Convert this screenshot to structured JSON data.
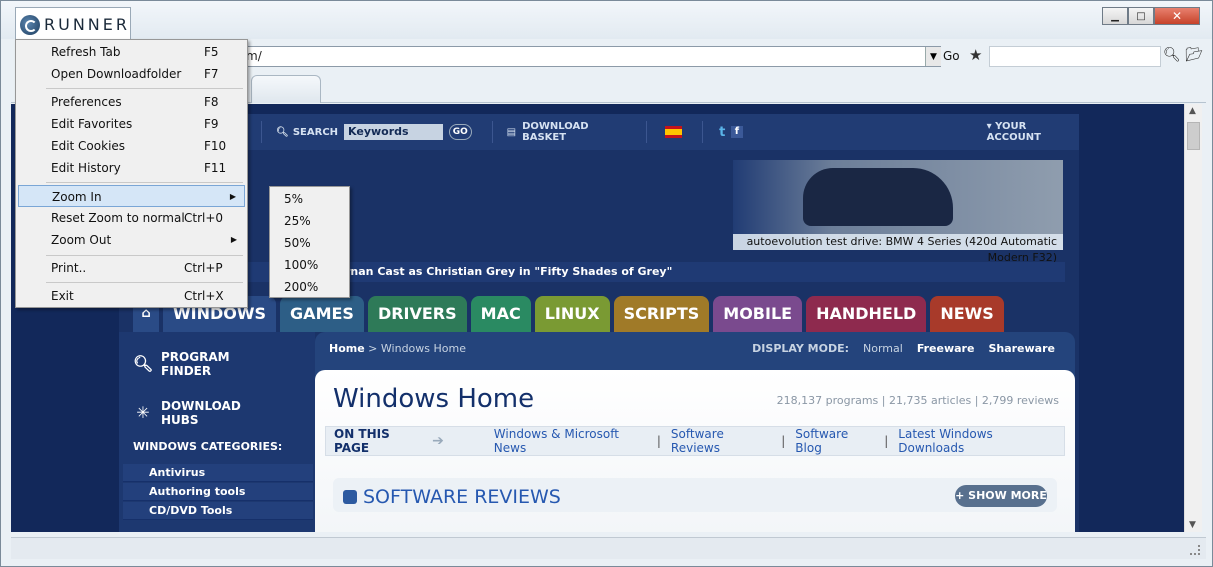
{
  "app": {
    "name": "RUNNER"
  },
  "window_controls": {
    "minimize": "▁",
    "maximize": "□",
    "close": "✕"
  },
  "address": {
    "url": "m/",
    "go_label": "Go"
  },
  "menu": {
    "items": [
      {
        "label": "Refresh Tab",
        "key": "F5"
      },
      {
        "label": "Open Downloadfolder",
        "key": "F7"
      },
      {
        "label": "Preferences",
        "key": "F8"
      },
      {
        "label": "Edit Favorites",
        "key": "F9"
      },
      {
        "label": "Edit Cookies",
        "key": "F10"
      },
      {
        "label": "Edit History",
        "key": "F11"
      },
      {
        "label": "Zoom In",
        "key": ""
      },
      {
        "label": "Reset Zoom to normal",
        "key": "Ctrl+0"
      },
      {
        "label": "Zoom Out",
        "key": ""
      },
      {
        "label": "Print..",
        "key": "Ctrl+P"
      },
      {
        "label": "Exit",
        "key": "Ctrl+X"
      }
    ],
    "zoom_options": [
      "5%",
      "25%",
      "50%",
      "100%",
      "200%"
    ]
  },
  "site": {
    "topnav": {
      "search": "SEARCH",
      "keywords": "Keywords",
      "go": "GO",
      "basket": "DOWNLOAD BASKET",
      "account": "YOUR ACCOUNT"
    },
    "banner_caption": "autoevolution test drive: BMW 4 Series (420d Automatic Modern F32)",
    "ticker": "rnan Cast as Christian Grey in \"Fifty Shades of Grey\"",
    "tabs": [
      {
        "label": "WINDOWS",
        "color": "#2a4b86"
      },
      {
        "label": "GAMES",
        "color": "#2d5e86"
      },
      {
        "label": "DRIVERS",
        "color": "#2e7a58"
      },
      {
        "label": "MAC",
        "color": "#2a8a62"
      },
      {
        "label": "LINUX",
        "color": "#7a9a33"
      },
      {
        "label": "SCRIPTS",
        "color": "#a07a28"
      },
      {
        "label": "MOBILE",
        "color": "#7a4a8e"
      },
      {
        "label": "HANDHELD",
        "color": "#8e2a4e"
      },
      {
        "label": "NEWS",
        "color": "#a83a2a"
      }
    ],
    "sidebar": {
      "program_finder": "PROGRAM FINDER",
      "download_hubs": "DOWNLOAD HUBS",
      "categories_title": "WINDOWS CATEGORIES:",
      "categories": [
        "Antivirus",
        "Authoring tools",
        "CD/DVD Tools"
      ]
    },
    "breadcrumb": {
      "home": "Home",
      "sep": " > ",
      "current": "Windows Home"
    },
    "display_mode": {
      "label": "DISPLAY MODE:",
      "normal": "Normal",
      "freeware": "Freeware",
      "shareware": "Shareware"
    },
    "title": "Windows Home",
    "counts": "218,137 programs | 21,735 articles | 2,799 reviews",
    "on_this_page": {
      "label": "ON THIS PAGE",
      "links": [
        "Windows & Microsoft News",
        "Software Reviews",
        "Software Blog",
        "Latest Windows Downloads"
      ]
    },
    "section": {
      "title": "SOFTWARE REVIEWS",
      "show_more": "+ SHOW MORE"
    }
  }
}
